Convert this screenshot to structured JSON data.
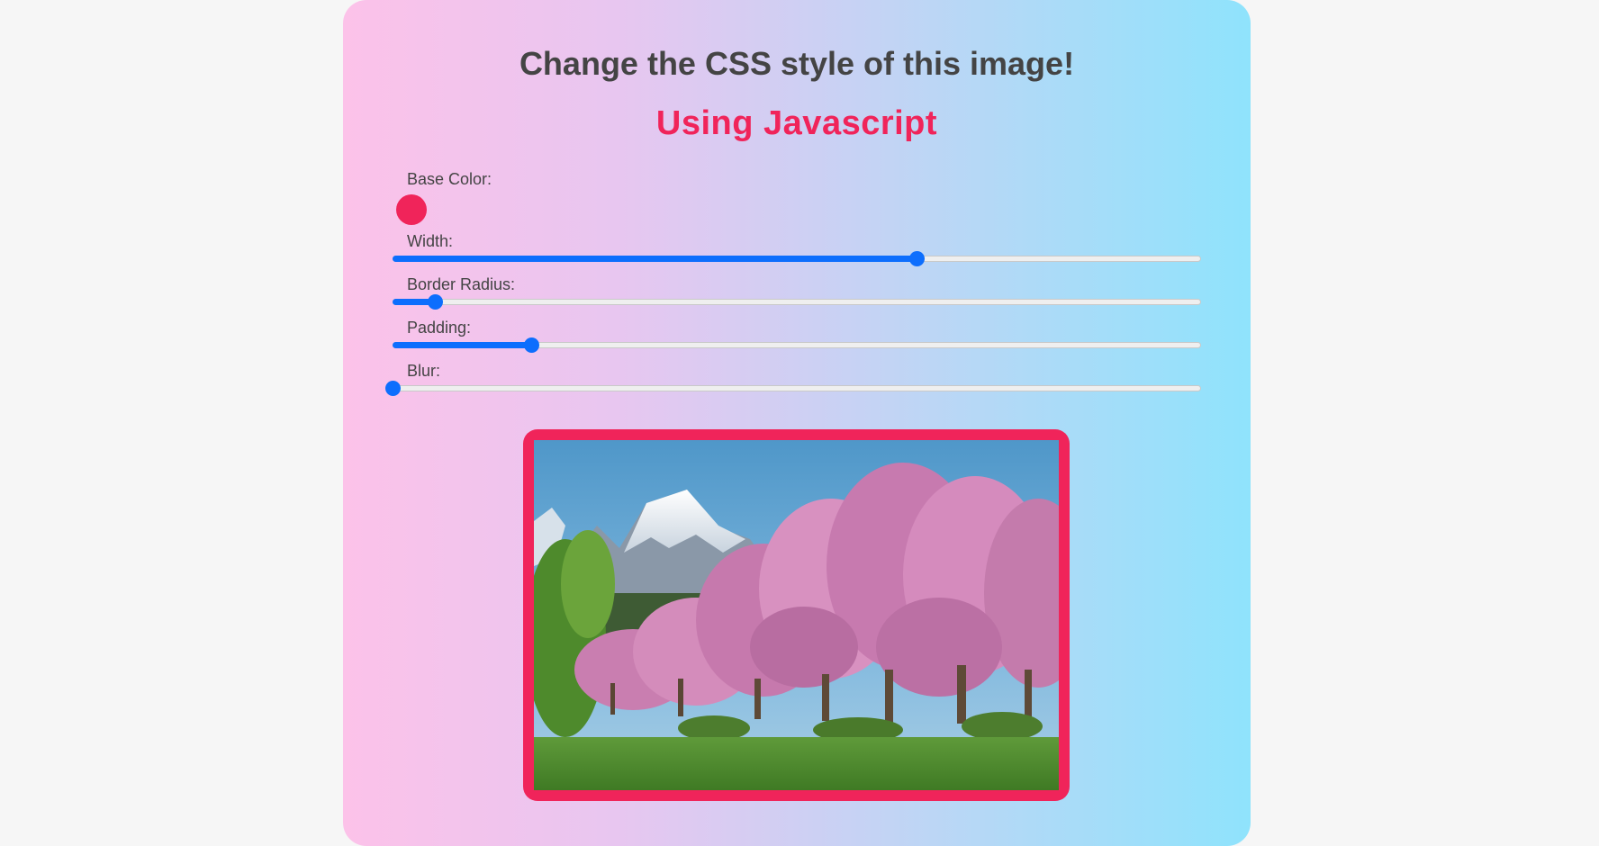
{
  "page": {
    "title": "Change the CSS style of this image!",
    "subtitle": "Using Javascript"
  },
  "controls": {
    "base_color_label": "Base Color:",
    "base_color_value": "#f0245a",
    "sliders": [
      {
        "key": "width",
        "label": "Width:",
        "level": 0.648
      },
      {
        "key": "border-radius",
        "label": "Border Radius:",
        "level": 0.052
      },
      {
        "key": "padding",
        "label": "Padding:",
        "level": 0.172
      },
      {
        "key": "blur",
        "label": "Blur:",
        "level": 0.0
      }
    ]
  },
  "colors": {
    "accent": "#f0245a",
    "slider": "#0d6efd",
    "text": "#444444"
  },
  "image": {
    "subject": "pink-blossom-trees-with-snowy-mountain"
  }
}
